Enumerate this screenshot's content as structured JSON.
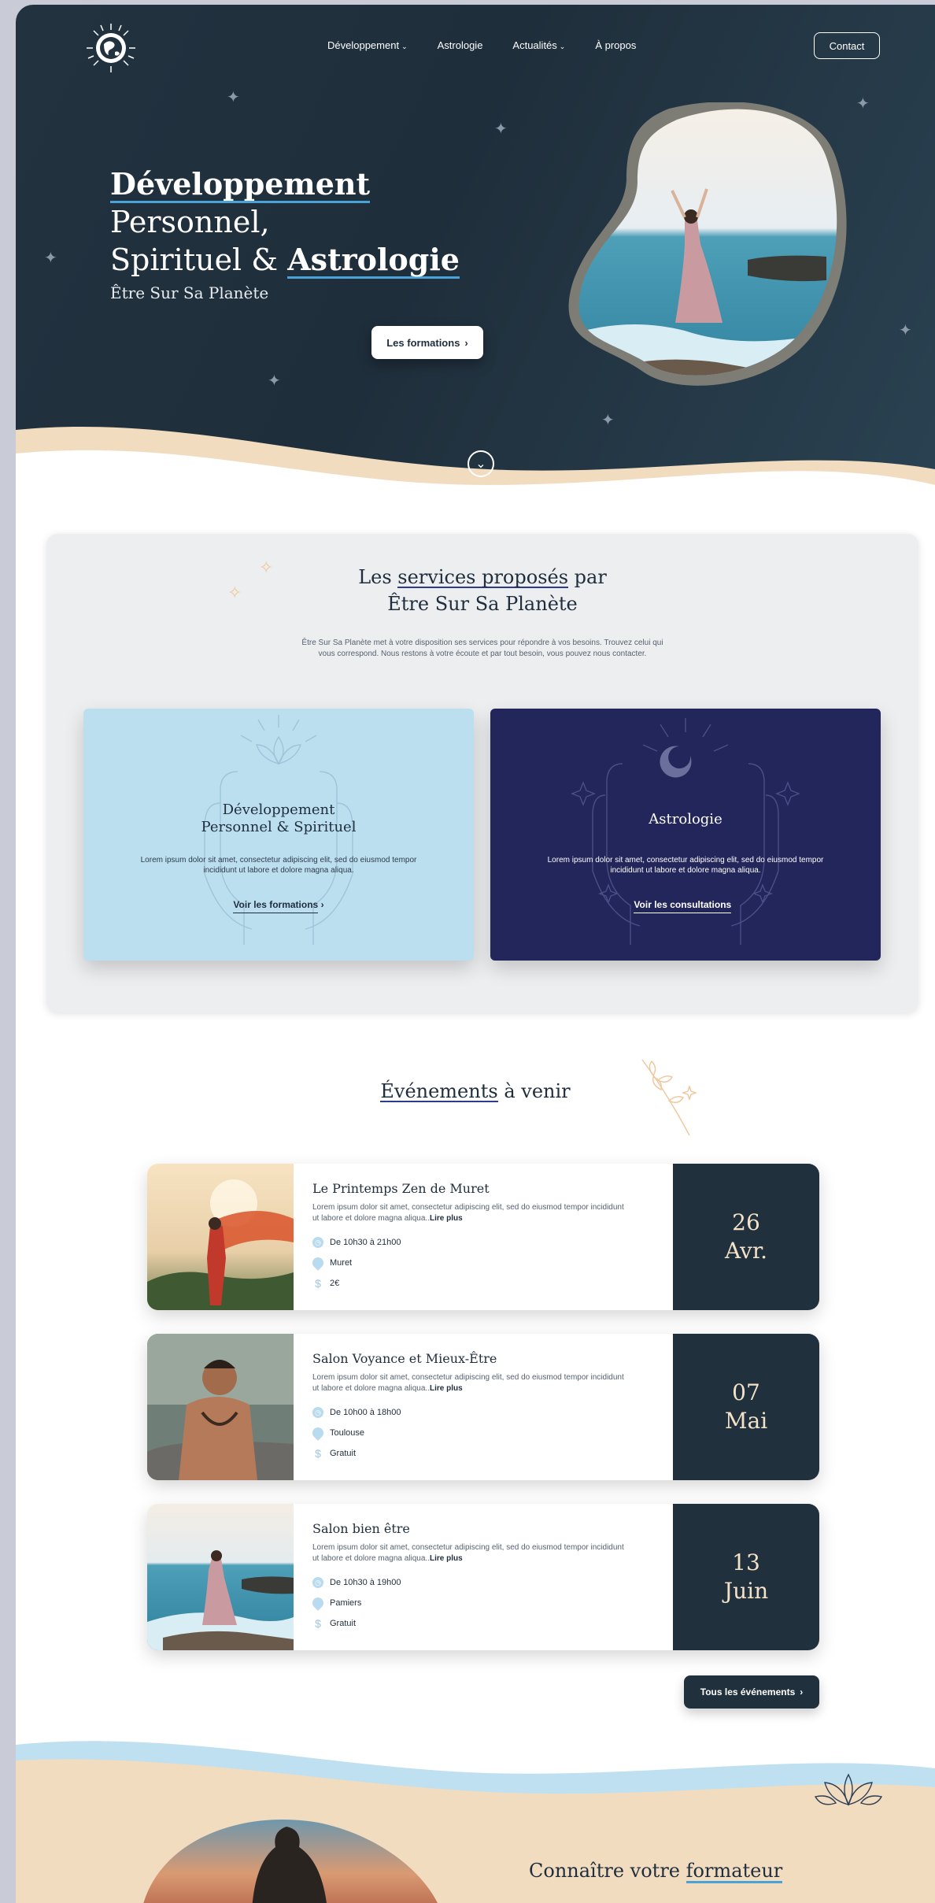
{
  "nav": {
    "items": [
      {
        "label": "Développement",
        "dropdown": true
      },
      {
        "label": "Astrologie",
        "dropdown": false
      },
      {
        "label": "Actualités",
        "dropdown": true
      },
      {
        "label": "À propos",
        "dropdown": false
      }
    ],
    "contact_label": "Contact"
  },
  "hero": {
    "title_bold_1": "Développement",
    "title_rest_1": " Personnel,",
    "title_line2_pre": "Spirituel & ",
    "title_bold_2": "Astrologie",
    "subtitle": "Être Sur Sa Planète",
    "cta_label": "Les formations"
  },
  "services": {
    "title_pre": "Les ",
    "title_highlight": "services proposés",
    "title_post": " par",
    "title_line2": "Être Sur Sa Planète",
    "description": "Être Sur Sa Planète met à votre disposition ses services pour répondre à vos besoins. Trouvez celui qui vous correspond. Nous restons à votre écoute et par tout besoin, vous pouvez nous contacter.",
    "cards": [
      {
        "title_line1": "Développement",
        "title_line2": "Personnel & Spirituel",
        "text": "Lorem ipsum dolor sit amet, consectetur adipiscing elit, sed do eiusmod tempor incididunt ut labore et dolore magna aliqua.",
        "link": "Voir les formations"
      },
      {
        "title_line1": "Astrologie",
        "title_line2": "",
        "text": "Lorem ipsum dolor sit amet, consectetur adipiscing elit, sed do eiusmod tempor incididunt ut labore et dolore magna aliqua.",
        "link": "Voir les consultations"
      }
    ]
  },
  "events": {
    "title_highlight": "Événements",
    "title_rest": " à venir",
    "read_more": "Lire plus",
    "items": [
      {
        "name": "Le Printemps Zen de Muret",
        "text": "Lorem ipsum dolor sit amet, consectetur adipiscing elit, sed do eiusmod tempor incididunt ut labore et dolore magna aliqua..",
        "hours": "De 10h30 à 21h00",
        "place": "Muret",
        "price": "2€",
        "day": "26",
        "month": "Avr."
      },
      {
        "name": "Salon Voyance et Mieux-Être",
        "text": "Lorem ipsum dolor sit amet, consectetur adipiscing elit, sed do eiusmod tempor incididunt ut labore et dolore magna aliqua..",
        "hours": "De 10h00 à 18h00",
        "place": "Toulouse",
        "price": "Gratuit",
        "day": "07",
        "month": "Mai"
      },
      {
        "name": "Salon bien être",
        "text": "Lorem ipsum dolor sit amet, consectetur adipiscing elit, sed do eiusmod tempor incididunt ut labore et dolore magna aliqua..",
        "hours": "De 10h30 à 19h00",
        "place": "Pamiers",
        "price": "Gratuit",
        "day": "13",
        "month": "Juin"
      }
    ],
    "all_label": "Tous les événements"
  },
  "trainer": {
    "title_pre": "Connaître votre ",
    "title_highlight": "formateur"
  },
  "colors": {
    "hero_bg": "#22323f",
    "accent_blue": "#4aa3d8",
    "sand": "#f1dcc0",
    "navy_card": "#23265a",
    "light_card": "#bcdff0"
  }
}
